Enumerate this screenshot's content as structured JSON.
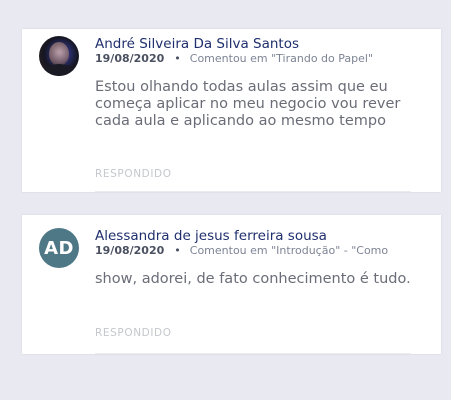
{
  "comments": [
    {
      "author": "André Silveira Da Silva Santos",
      "date": "19/08/2020",
      "separator": "•",
      "context": "Comentou em \"Tirando do Papel\"",
      "text": "Estou olhando todas aulas assim que eu começa aplicar no meu negocio vou rever cada aula e aplicando ao mesmo tempo",
      "status": "RESPONDIDO",
      "avatar": {
        "type": "photo"
      }
    },
    {
      "author": "Alessandra de jesus ferreira sousa",
      "date": "19/08/2020",
      "separator": "•",
      "context": "Comentou em \"Introdução\" - \"Como",
      "text": "show, adorei, de fato conhecimento é tudo.",
      "status": "RESPONDIDO",
      "avatar": {
        "type": "initials",
        "initials": "AD",
        "color": "#4f7886"
      }
    }
  ],
  "colors": {
    "background": "#e9eaf1",
    "author": "#1f2f6d",
    "comment": "#6a6d77",
    "status": "#c5c7cd"
  }
}
